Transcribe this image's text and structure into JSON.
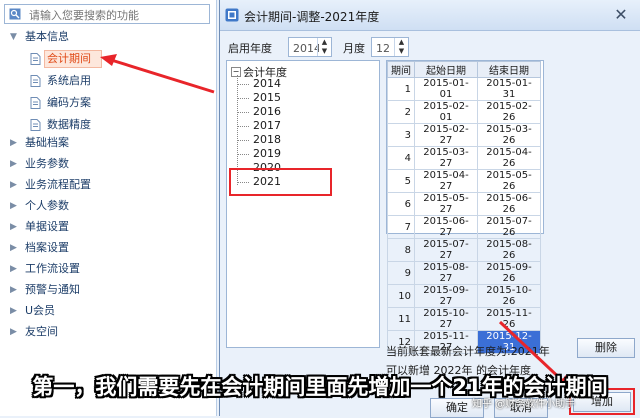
{
  "nav": {
    "search_placeholder": "请输入您要搜索的功能",
    "groups": [
      {
        "label": "基本信息"
      },
      {
        "label": "基础档案"
      },
      {
        "label": "业务参数"
      },
      {
        "label": "业务流程配置"
      },
      {
        "label": "个人参数"
      },
      {
        "label": "单据设置"
      },
      {
        "label": "档案设置"
      },
      {
        "label": "工作流设置"
      },
      {
        "label": "预警与通知"
      },
      {
        "label": "U会员"
      },
      {
        "label": "友空间"
      }
    ],
    "sub_items": [
      {
        "label": "会计期间"
      },
      {
        "label": "系统启用"
      },
      {
        "label": "编码方案"
      },
      {
        "label": "数据精度"
      }
    ]
  },
  "dialog": {
    "title": "会计期间-调整-2021年度",
    "start_year_label": "启用年度",
    "start_year_value": "2014",
    "month_label": "月度",
    "month_value": "12",
    "tree_root": "会计年度",
    "years": [
      "2014",
      "2015",
      "2016",
      "2017",
      "2018",
      "2019",
      "2020",
      "2021"
    ],
    "table": {
      "headers": [
        "期间",
        "起始日期",
        "结束日期"
      ],
      "rows": [
        [
          "1",
          "2015-01-01",
          "2015-01-31"
        ],
        [
          "2",
          "2015-02-01",
          "2015-02-26"
        ],
        [
          "3",
          "2015-02-27",
          "2015-03-26"
        ],
        [
          "4",
          "2015-03-27",
          "2015-04-26"
        ],
        [
          "5",
          "2015-04-27",
          "2015-05-26"
        ],
        [
          "6",
          "2015-05-27",
          "2015-06-26"
        ],
        [
          "7",
          "2015-06-27",
          "2015-07-26"
        ],
        [
          "8",
          "2015-07-27",
          "2015-08-26"
        ],
        [
          "9",
          "2015-08-27",
          "2015-09-26"
        ],
        [
          "10",
          "2015-09-27",
          "2015-10-26"
        ],
        [
          "11",
          "2015-10-27",
          "2015-11-26"
        ],
        [
          "12",
          "2015-11-27",
          "2015-12-31"
        ]
      ]
    },
    "current_year_text": "当前账套最新会计年度为:2021年",
    "partial_text": "可以新增 2022年 的会计年度",
    "delete_label": "删除",
    "add_label": "增加",
    "confirm_label": "确定",
    "cancel_label": "取消"
  },
  "caption": "第一，我们需要先在会计期间里面先增加一个21年的会计期间",
  "watermark": "知乎 @财务软件小助手",
  "colors": {
    "highlight": "#e04a17",
    "annotation_red": "#e8252a",
    "selection_blue": "#3b6fd6"
  }
}
